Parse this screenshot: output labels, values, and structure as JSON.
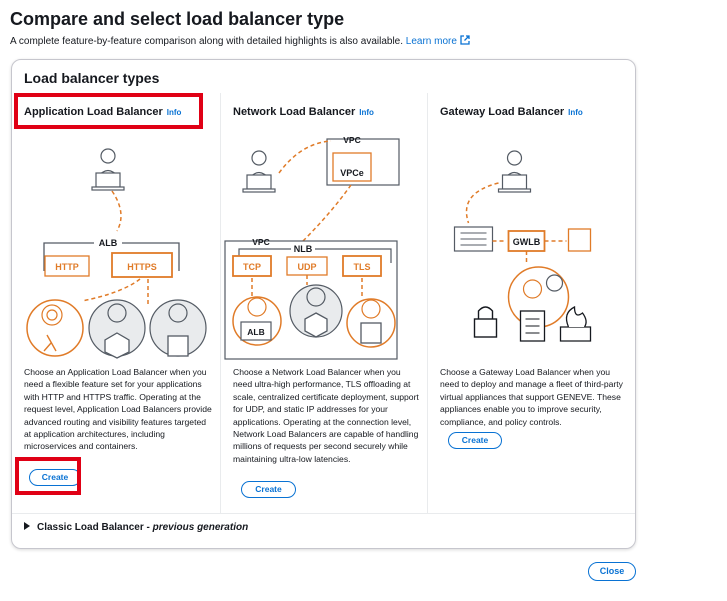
{
  "header": {
    "title": "Compare and select load balancer type",
    "subtitle": "A complete feature-by-feature comparison along with detailed highlights is also available.",
    "learn_more": "Learn more"
  },
  "panel": {
    "title": "Load balancer types",
    "columns": [
      {
        "name": "Application Load Balancer",
        "info": "Info",
        "diagram": {
          "top_label": "ALB",
          "protocols": [
            "HTTP",
            "HTTPS"
          ]
        },
        "description": "Choose an Application Load Balancer when you need a flexible feature set for your applications with HTTP and HTTPS traffic. Operating at the request level, Application Load Balancers provide advanced routing and visibility features targeted at application architectures, including microservices and containers.",
        "button": "Create"
      },
      {
        "name": "Network Load Balancer",
        "info": "Info",
        "diagram": {
          "vpc_top": "VPC",
          "vpce": "VPCe",
          "vpc_label": "VPC",
          "nlb_label": "NLB",
          "protocols": [
            "TCP",
            "UDP",
            "TLS"
          ],
          "alb_box": "ALB"
        },
        "description": "Choose a Network Load Balancer when you need ultra-high performance, TLS offloading at scale, centralized certificate deployment, support for UDP, and static IP addresses for your applications. Operating at the connection level, Network Load Balancers are capable of handling millions of requests per second securely while maintaining ultra-low latencies.",
        "button": "Create"
      },
      {
        "name": "Gateway Load Balancer",
        "info": "Info",
        "diagram": {
          "gwlb_label": "GWLB"
        },
        "description": "Choose a Gateway Load Balancer when you need to deploy and manage a fleet of third-party virtual appliances that support GENEVE. These appliances enable you to improve security, compliance, and policy controls.",
        "button": "Create"
      }
    ],
    "classic": {
      "label": "Classic Load Balancer - ",
      "suffix": "previous generation"
    }
  },
  "footer": {
    "close": "Close"
  },
  "colors": {
    "link": "#0972d3",
    "accent_orange": "#e07b28",
    "highlight_red": "#e00015",
    "text": "#16191f",
    "border": "#c6c6cd"
  }
}
